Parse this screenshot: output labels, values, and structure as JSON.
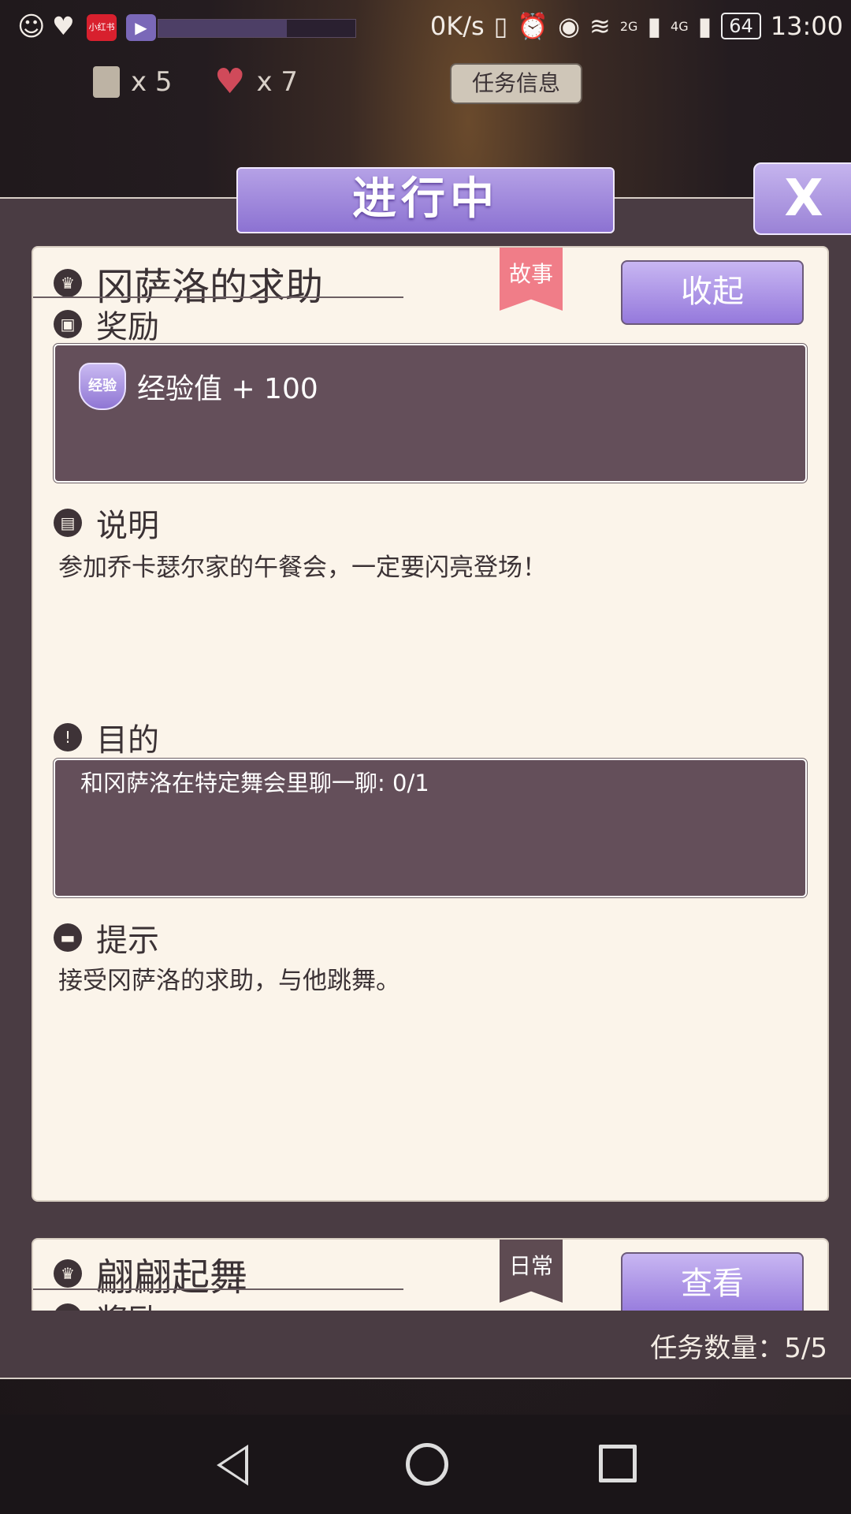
{
  "status_bar": {
    "app_badge": "小红书",
    "net_speed": "0K/s",
    "signal_2g": "2G",
    "signal_4g": "4G",
    "battery": "64",
    "time": "13:00"
  },
  "resources": {
    "scrolls": "x 5",
    "hearts": "x 7"
  },
  "task_info_button": "任务信息",
  "panel": {
    "title": "进行中",
    "close_label": "X"
  },
  "quest1": {
    "title": "冈萨洛的求助",
    "tag": "故事",
    "action": "收起",
    "reward_header": "奖励",
    "reward_badge": "经验",
    "reward_text": "经验值 + 100",
    "desc_header": "说明",
    "desc_text": "参加乔卡瑟尔家的午餐会，一定要闪亮登场！",
    "goal_header": "目的",
    "goal_text": "和冈萨洛在特定舞会里聊一聊: 0/1",
    "hint_header": "提示",
    "hint_text": "接受冈萨洛的求助，与他跳舞。"
  },
  "quest2": {
    "title": "翩翩起舞",
    "tag": "日常",
    "action": "查看",
    "reward_header": "奖励"
  },
  "task_count": "任务数量：5/5",
  "colors": {
    "accent_purple": "#9a82d6",
    "story_tag": "#f07d88",
    "card_bg": "#fbf4ea",
    "dark_box": "#644f5a"
  }
}
